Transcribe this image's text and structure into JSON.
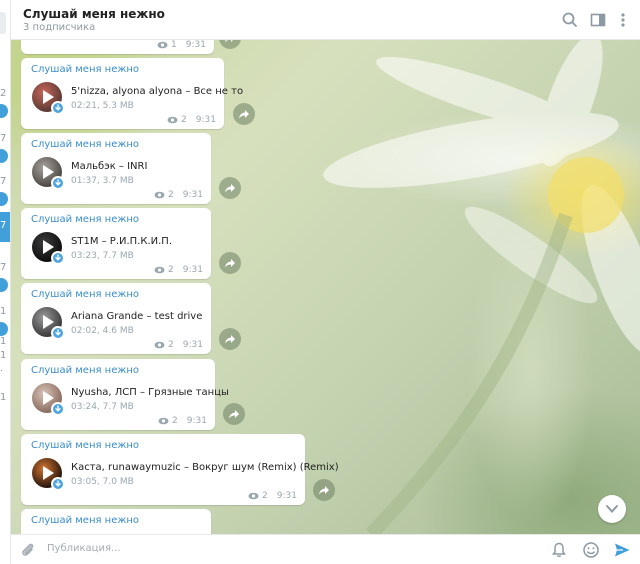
{
  "header": {
    "title": "Слушай меня нежно",
    "subtitle": "3 подписчика"
  },
  "left_strip": {
    "numbers": [
      "2",
      "7",
      "7",
      "7",
      "7",
      "1",
      "1",
      "1",
      "·",
      "1"
    ]
  },
  "top_partial": {
    "views": "1",
    "time": "9:31"
  },
  "messages": [
    {
      "author": "Слушай меня нежно",
      "track": "5'nizza, alyona alyona – Все не то",
      "meta": "02:21, 5.3 MB",
      "views": "2",
      "time": "9:31"
    },
    {
      "author": "Слушай меня нежно",
      "track": "Мальбэк – INRI",
      "meta": "01:37, 3.7 MB",
      "views": "2",
      "time": "9:31"
    },
    {
      "author": "Слушай меня нежно",
      "track": "ST1M – Р.И.П.К.И.П.",
      "meta": "03:23, 7.7 MB",
      "views": "2",
      "time": "9:31"
    },
    {
      "author": "Слушай меня нежно",
      "track": "Ariana Grande – test drive",
      "meta": "02:02, 4.6 MB",
      "views": "2",
      "time": "9:31"
    },
    {
      "author": "Слушай меня нежно",
      "track": "Nyusha, ЛСП – Грязные танцы",
      "meta": "03:24, 7.7 MB",
      "views": "2",
      "time": "9:31"
    },
    {
      "author": "Слушай меня нежно",
      "track": "Каста, runawaymuzic – Вокруг шум (Remix) (Remix)",
      "meta": "03:05, 7.0 MB",
      "views": "2",
      "time": "9:31"
    },
    {
      "author": "Слушай меня нежно"
    }
  ],
  "composer": {
    "placeholder": "Публикация..."
  },
  "icons": {
    "search": "search-icon",
    "sidebar": "sidebar-toggle-icon",
    "more": "more-vertical-icon",
    "attach": "paperclip-icon",
    "bell": "bell-icon",
    "emoji": "emoji-icon",
    "send": "send-icon",
    "share": "share-arrow-icon",
    "views": "eye-icon",
    "download": "download-icon",
    "scroll_down": "chevron-down-icon"
  },
  "colors": {
    "accent": "#419fd9",
    "author": "#3a8dca",
    "muted": "#9aa7b0"
  }
}
